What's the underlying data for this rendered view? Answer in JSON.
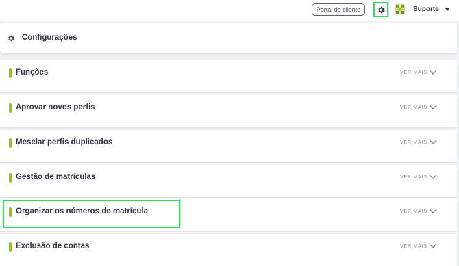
{
  "topbar": {
    "portal_label": "Portal do cliente",
    "user_name": "Suporte",
    "icons": {
      "settings": "gear-icon",
      "avatar": "avatar",
      "caret": "caret-down-icon"
    }
  },
  "header": {
    "title": "Configurações",
    "icon": "gear-icon"
  },
  "sections": [
    {
      "title": "Funções",
      "more": "VER MAIS"
    },
    {
      "title": "Aprovar novos perfis",
      "more": "VER MAIS"
    },
    {
      "title": "Mesclar perfis duplicados",
      "more": "VER MAIS"
    },
    {
      "title": "Gestão de matrículas",
      "more": "VER MAIS"
    },
    {
      "title": "Organizar os números de matrícula",
      "more": "VER MAIS"
    },
    {
      "title": "Exclusão de contas",
      "more": "VER MAIS"
    }
  ],
  "colors": {
    "accent_bar": "#8ec21e",
    "highlight": "#23e84b",
    "background": "#f1f2f4"
  }
}
